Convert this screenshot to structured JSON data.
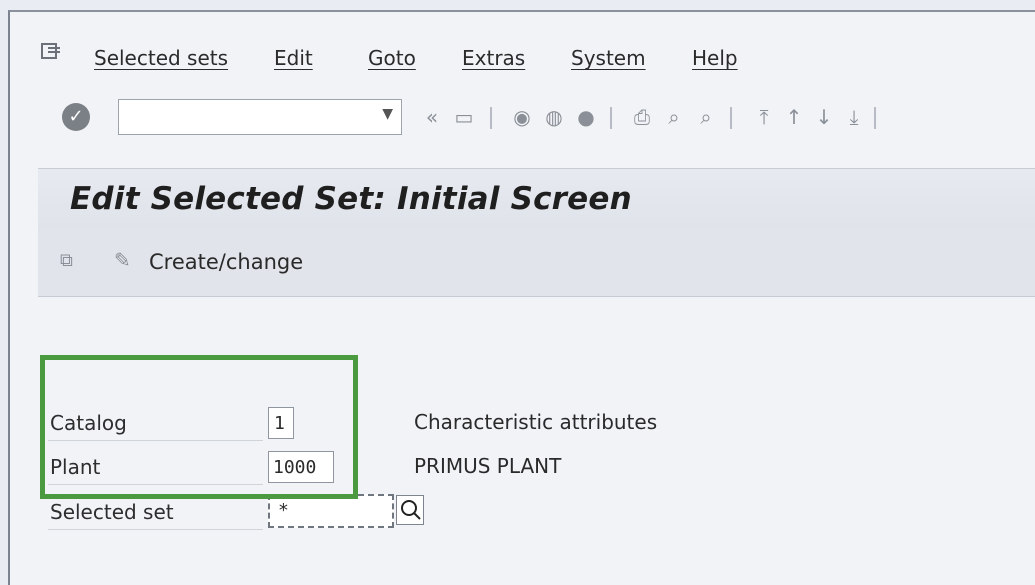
{
  "menu": {
    "items": [
      "Selected sets",
      "Edit",
      "Goto",
      "Extras",
      "System",
      "Help"
    ]
  },
  "toolbar": {
    "command_value": "",
    "icons": [
      "enter-icon",
      "back-icon",
      "save-icon",
      "exit-icon",
      "cancel-icon",
      "print-icon",
      "find-icon",
      "find-next-icon",
      "first-page-icon",
      "previous-page-icon",
      "next-page-icon",
      "last-page-icon"
    ]
  },
  "screen": {
    "title": "Edit Selected Set: Initial Screen",
    "create_change_label": "Create/change"
  },
  "fields": {
    "catalog_label": "Catalog",
    "catalog_value": "1",
    "catalog_desc": "Characteristic attributes",
    "plant_label": "Plant",
    "plant_value": "1000",
    "plant_desc": "PRIMUS PLANT",
    "selected_set_label": "Selected set",
    "selected_set_value": "*"
  },
  "colors": {
    "highlight": "#4c9a3f"
  }
}
